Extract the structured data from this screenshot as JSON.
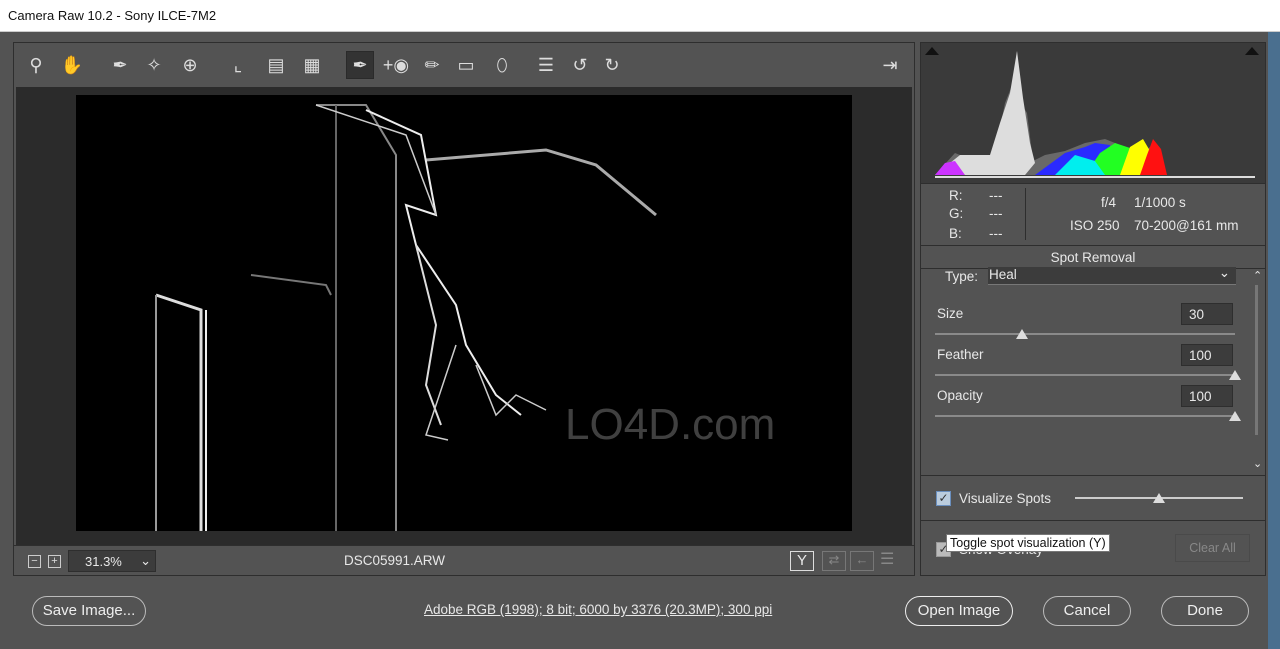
{
  "window": {
    "title": "Camera Raw 10.2  -  Sony ILCE-7M2"
  },
  "toolbar": {
    "tools": [
      "zoom-tool",
      "hand-tool",
      "white-balance-tool",
      "color-sampler-tool",
      "targeted-adjustment-tool",
      "crop-tool",
      "straighten-tool",
      "transform-tool",
      "spot-removal-tool",
      "red-eye-tool",
      "adjustment-brush",
      "graduated-filter",
      "radial-filter",
      "open-preferences",
      "rotate-left",
      "rotate-right"
    ],
    "selected": "spot-removal-tool",
    "fullscreen": "toggle-fullscreen"
  },
  "status": {
    "zoom": "31.3%",
    "filename": "DSC05991.ARW",
    "zoom_out": "−",
    "zoom_in": "+",
    "y_label": "Y"
  },
  "info": {
    "r_label": "R:",
    "g_label": "G:",
    "b_label": "B:",
    "r": "---",
    "g": "---",
    "b": "---",
    "aperture": "f/4",
    "shutter": "1/1000 s",
    "iso": "ISO 250",
    "lens": "70-200@161 mm"
  },
  "spot": {
    "title": "Spot Removal",
    "type_label": "Type:",
    "type_value": "Heal",
    "size_label": "Size",
    "size": "30",
    "size_pct": 0.29,
    "feather_label": "Feather",
    "feather": "100",
    "feather_pct": 1.0,
    "opacity_label": "Opacity",
    "opacity": "100",
    "opacity_pct": 1.0,
    "visualize_label": "Visualize Spots",
    "visualize_checked": true,
    "visualize_pct": 0.5,
    "overlay_label": "Show Overlay",
    "overlay_checked": true,
    "clear_all": "Clear All",
    "tooltip": "Toggle spot visualization (Y)"
  },
  "footer": {
    "save": "Save Image...",
    "workflow": "Adobe RGB (1998); 8 bit; 6000 by 3376 (20.3MP); 300 ppi",
    "open": "Open Image",
    "cancel": "Cancel",
    "done": "Done"
  },
  "watermark": "LO4D.com"
}
